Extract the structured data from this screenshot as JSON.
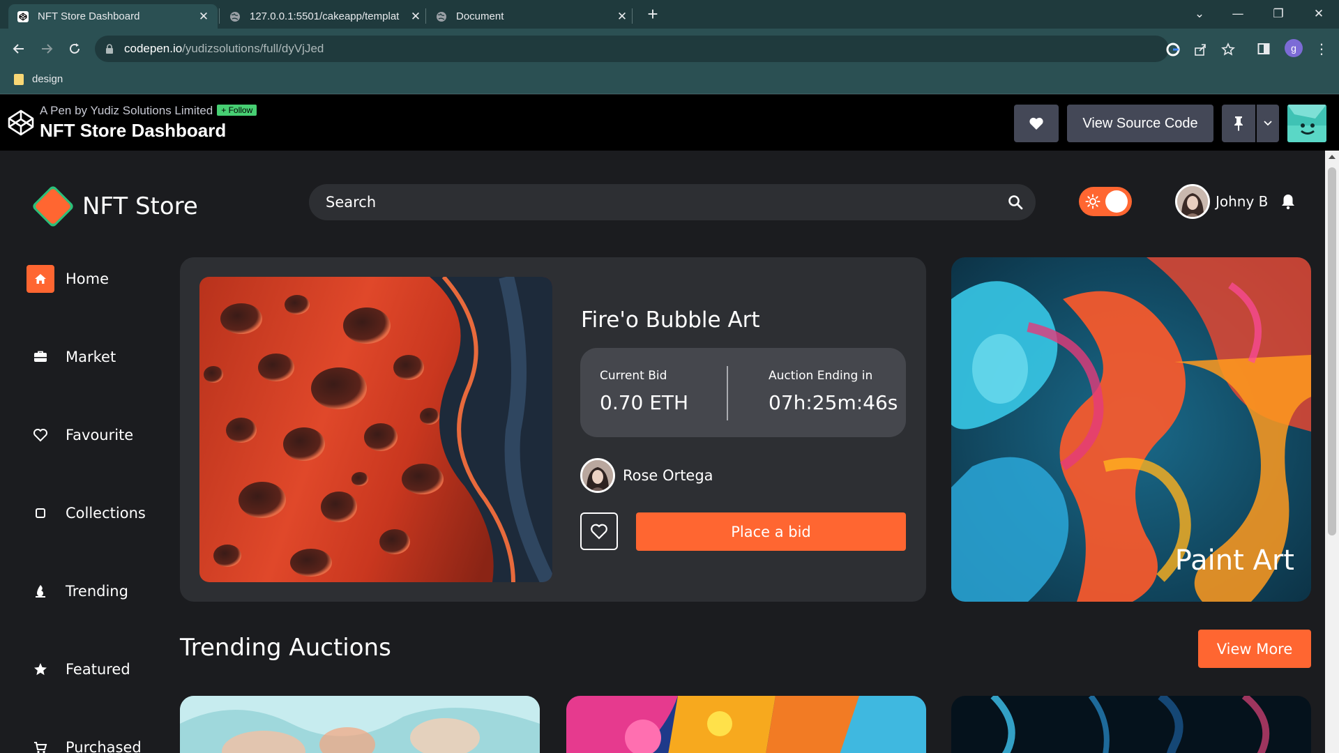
{
  "browser": {
    "tabs": [
      {
        "title": "NFT Store Dashboard",
        "active": true
      },
      {
        "title": "127.0.0.1:5501/cakeapp/templat",
        "active": false
      },
      {
        "title": "Document",
        "active": false
      }
    ],
    "url_host": "codepen.io",
    "url_path": "/yudizsolutions/full/dyVjJed",
    "profile_initial": "g",
    "bookmarks": [
      {
        "label": "design"
      }
    ]
  },
  "codepen": {
    "byline": "A Pen by Yudiz Solutions Limited",
    "follow_label": "+ Follow",
    "title": "NFT Store Dashboard",
    "view_source_label": "View Source Code"
  },
  "app": {
    "brand": "NFT Store",
    "search_placeholder": "Search",
    "user_name": "Johny B",
    "accent_color": "#ff6631",
    "sidebar": [
      {
        "label": "Home",
        "icon": "home-icon",
        "active": true
      },
      {
        "label": "Market",
        "icon": "briefcase-icon",
        "active": false
      },
      {
        "label": "Favourite",
        "icon": "heart-icon",
        "active": false
      },
      {
        "label": "Collections",
        "icon": "square-icon",
        "active": false
      },
      {
        "label": "Trending",
        "icon": "fire-icon",
        "active": false
      },
      {
        "label": "Featured",
        "icon": "star-icon",
        "active": false
      },
      {
        "label": "Purchased",
        "icon": "cart-icon",
        "active": false
      }
    ],
    "hero": {
      "title": "Fire'o Bubble Art",
      "current_bid_label": "Current Bid",
      "current_bid": "0.70 ETH",
      "auction_label": "Auction Ending in",
      "auction_time": "07h:25m:46s",
      "creator": "Rose Ortega",
      "bid_button": "Place a bid"
    },
    "side_art": {
      "title": "Paint Art"
    },
    "trending": {
      "title": "Trending Auctions",
      "view_more": "View More"
    }
  }
}
